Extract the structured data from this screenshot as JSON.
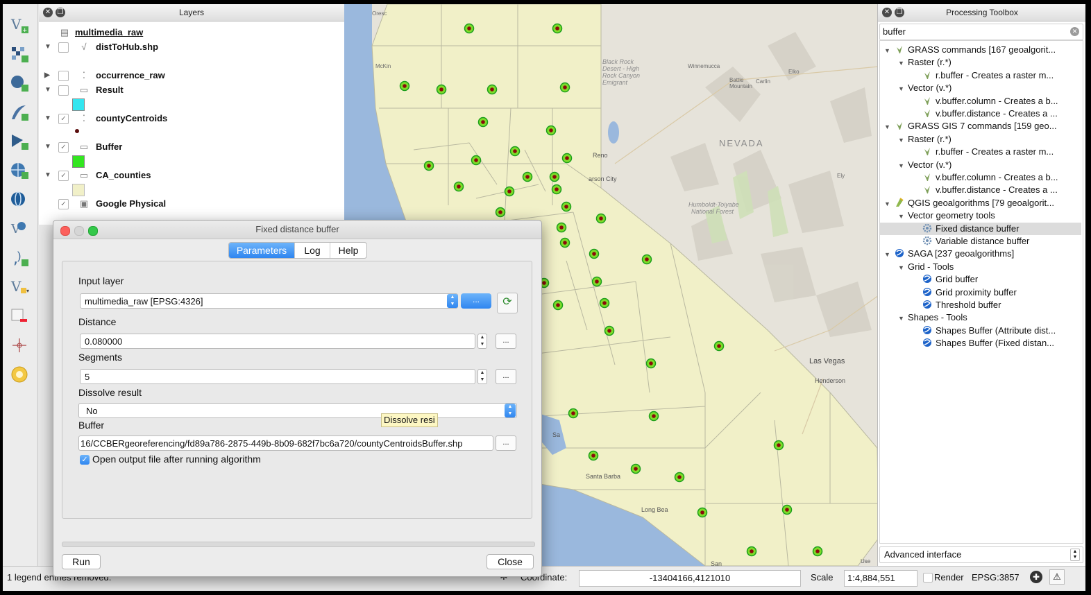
{
  "layers_panel": {
    "title": "Layers",
    "layers": [
      {
        "name": "multimedia_raw",
        "checked": false,
        "expanded": null,
        "kind": "table"
      },
      {
        "name": "distToHub.shp",
        "checked": false,
        "expanded": true,
        "kind": "line"
      },
      {
        "name": "occurrence_raw",
        "checked": false,
        "expanded": false,
        "kind": "point"
      },
      {
        "name": "Result",
        "checked": false,
        "expanded": true,
        "kind": "polygon"
      },
      {
        "name": "countyCentroids",
        "checked": true,
        "expanded": true,
        "kind": "point"
      },
      {
        "name": "Buffer",
        "checked": true,
        "expanded": true,
        "kind": "polygon"
      },
      {
        "name": "CA_counties",
        "checked": true,
        "expanded": true,
        "kind": "polygon"
      },
      {
        "name": "Google Physical",
        "checked": true,
        "expanded": null,
        "kind": "raster"
      }
    ],
    "swatch_colors": {
      "result": "#33e6f0",
      "buffer": "#33e620",
      "ca_counties": "#f1f0c8"
    }
  },
  "map": {
    "labels": {
      "nevada": "NEVADA",
      "reno": "Reno",
      "carson_city": "arson City",
      "las_vegas": "Las Vegas",
      "henderson": "Henderson",
      "santa_barbara": "Santa Barba",
      "long_beach": "Long Bea",
      "black_rock": "Black Rock Desert - High Rock Canyon Emigrant",
      "humboldt": "Humboldt-Toiyabe National Forest",
      "winnemucca": "Winnemucca",
      "battle_mountain": "Battle Mountain",
      "carlin": "Carlin",
      "elko": "Elko",
      "mckin": "McKin",
      "oresc": "Oresc",
      "ely": "Ely",
      "sa": "Sa",
      "sac": "San",
      "use": "Use"
    },
    "colors": {
      "ocean": "#9ab8dd",
      "land": "#e9e6de",
      "counties": "#f1f0c8",
      "centroid_ring": "#1b9e1b",
      "centroid_fill": "#7ddb2a",
      "centroid_dot": "#8b0a0a"
    }
  },
  "toolbox": {
    "title": "Processing Toolbox",
    "search_value": "buffer",
    "tree": [
      {
        "level": 0,
        "label": "GRASS commands [167 geoalgorit...",
        "icon": "grass-icon",
        "expanded": true
      },
      {
        "level": 1,
        "label": "Raster (r.*)",
        "icon": "",
        "expanded": true
      },
      {
        "level": 2,
        "label": "r.buffer - Creates a raster m...",
        "icon": "grass-icon"
      },
      {
        "level": 1,
        "label": "Vector (v.*)",
        "icon": "",
        "expanded": true
      },
      {
        "level": 2,
        "label": "v.buffer.column - Creates a b...",
        "icon": "grass-icon"
      },
      {
        "level": 2,
        "label": "v.buffer.distance - Creates a ...",
        "icon": "grass-icon"
      },
      {
        "level": 0,
        "label": "GRASS GIS 7 commands [159 geo...",
        "icon": "grass-icon",
        "expanded": true
      },
      {
        "level": 1,
        "label": "Raster (r.*)",
        "icon": "",
        "expanded": true
      },
      {
        "level": 2,
        "label": "r.buffer - Creates a raster m...",
        "icon": "grass-icon"
      },
      {
        "level": 1,
        "label": "Vector (v.*)",
        "icon": "",
        "expanded": true
      },
      {
        "level": 2,
        "label": "v.buffer.column - Creates a b...",
        "icon": "grass-icon"
      },
      {
        "level": 2,
        "label": "v.buffer.distance - Creates a ...",
        "icon": "grass-icon"
      },
      {
        "level": 0,
        "label": "QGIS geoalgorithms [79 geoalgorit...",
        "icon": "qgis-icon",
        "expanded": true
      },
      {
        "level": 1,
        "label": "Vector geometry tools",
        "icon": "",
        "expanded": true
      },
      {
        "level": 2,
        "label": "Fixed distance buffer",
        "icon": "gear-icon",
        "selected": true
      },
      {
        "level": 2,
        "label": "Variable distance buffer",
        "icon": "gear-icon"
      },
      {
        "level": 0,
        "label": "SAGA [237 geoalgorithms]",
        "icon": "saga-icon",
        "expanded": true
      },
      {
        "level": 1,
        "label": "Grid - Tools",
        "icon": "",
        "expanded": true
      },
      {
        "level": 2,
        "label": "Grid buffer",
        "icon": "saga-icon"
      },
      {
        "level": 2,
        "label": "Grid proximity buffer",
        "icon": "saga-icon"
      },
      {
        "level": 2,
        "label": "Threshold buffer",
        "icon": "saga-icon"
      },
      {
        "level": 1,
        "label": "Shapes - Tools",
        "icon": "",
        "expanded": true
      },
      {
        "level": 2,
        "label": "Shapes Buffer (Attribute dist...",
        "icon": "saga-icon"
      },
      {
        "level": 2,
        "label": "Shapes Buffer (Fixed distan...",
        "icon": "saga-icon"
      }
    ],
    "advanced_interface": "Advanced interface"
  },
  "status_bar": {
    "message": "1 legend entries removed.",
    "coordinate_label": "Coordinate:",
    "coordinate_value": "-13404166,4121010",
    "scale_label": "Scale",
    "scale_value": "1:4,884,551",
    "render_label": "Render",
    "epsg": "EPSG:3857"
  },
  "dialog": {
    "title": "Fixed distance buffer",
    "tabs": [
      "Parameters",
      "Log",
      "Help"
    ],
    "active_tab": 0,
    "input_layer_label": "Input layer",
    "input_layer_value": "multimedia_raw [EPSG:4326]",
    "browse_label": "...",
    "distance_label": "Distance",
    "distance_value": "0.080000",
    "segments_label": "Segments",
    "segments_value": "5",
    "dissolve_label": "Dissolve result",
    "dissolve_value": "No",
    "tooltip": "Dissolve resi",
    "buffer_label": "Buffer",
    "buffer_value": "16/CCBERgeoreferencing/fd89a786-2875-449b-8b09-682f7bc6a720/countyCentroidsBuffer.shp",
    "open_output_label": "Open output file after running algorithm",
    "open_output_checked": true,
    "run_label": "Run",
    "close_label": "Close"
  }
}
